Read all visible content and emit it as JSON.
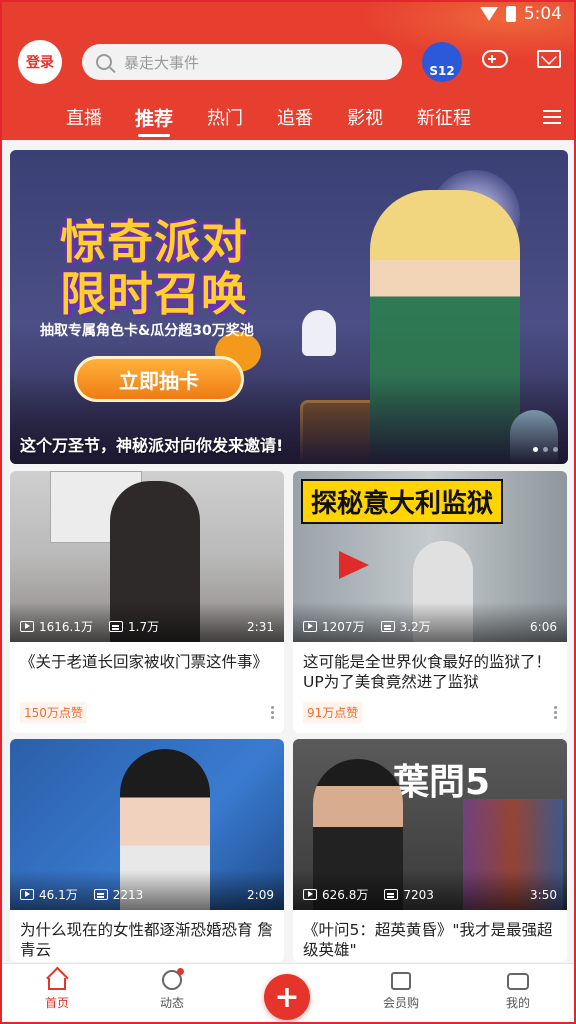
{
  "status": {
    "time": "5:04"
  },
  "header": {
    "login_label": "登录",
    "search_placeholder": "暴走大事件",
    "badge_label": "S12",
    "tabs": [
      "直播",
      "推荐",
      "热门",
      "追番",
      "影视",
      "新征程"
    ],
    "active_tab": "推荐",
    "accent_color": "#e63e2f"
  },
  "banner": {
    "title_line1": "惊奇派对",
    "title_line2": "限时召唤",
    "subline": "抽取专属角色卡&瓜分超30万奖池",
    "cta": "立即抽卡",
    "caption": "这个万圣节，神秘派对向你发来邀请!"
  },
  "cards": [
    {
      "title": "《关于老道长回家被收门票这件事》",
      "views": "1616.1万",
      "danmaku": "1.7万",
      "duration": "2:31",
      "tag": "150万点赞"
    },
    {
      "title": "这可能是全世界伙食最好的监狱了！UP为了美食竟然进了监狱",
      "views": "1207万",
      "danmaku": "3.2万",
      "duration": "6:06",
      "tag": "91万点赞",
      "thumb_text": "探秘意大利监狱"
    },
    {
      "title": "为什么现在的女性都逐渐恐婚恐育 詹青云",
      "views": "46.1万",
      "danmaku": "2213",
      "duration": "2:09"
    },
    {
      "title": "《叶问5：超英黄昏》\"我才是最强超级英雄\"",
      "views": "626.8万",
      "danmaku": "7203",
      "duration": "3:50",
      "thumb_text": "葉問5"
    }
  ],
  "nav": {
    "home": "首页",
    "dynamic": "动态",
    "plus": "+",
    "shop": "会员购",
    "mine": "我的"
  }
}
